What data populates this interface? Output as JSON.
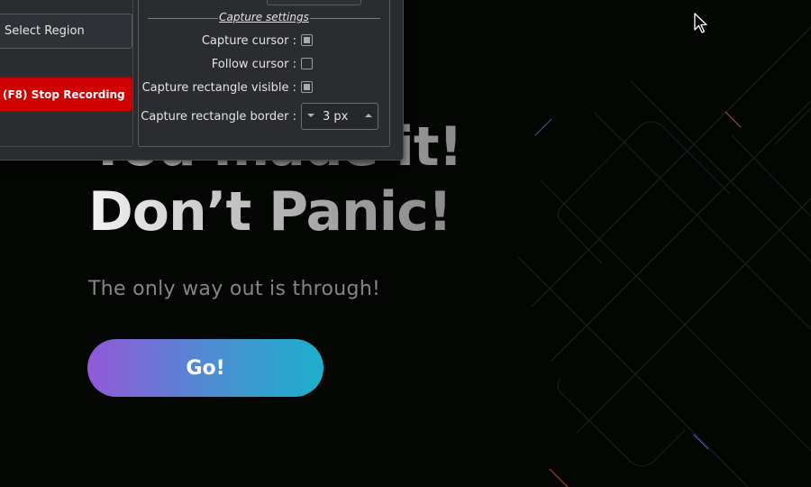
{
  "hero": {
    "line1": "You made it!",
    "line2": "Don’t Panic!",
    "subtitle": "The only way out is through!",
    "cta_label": "Go!"
  },
  "recorder": {
    "select_region_label": "Select Region",
    "stop_recording_label": "(F8) Stop Recording",
    "group_title": "Capture settings",
    "capture_cursor_label": "Capture cursor :",
    "capture_cursor_checked": true,
    "follow_cursor_label": "Follow cursor :",
    "follow_cursor_checked": false,
    "rect_visible_label": "Capture rectangle visible :",
    "rect_visible_checked": true,
    "rect_border_label": "Capture rectangle border :",
    "rect_border_value": "3 px"
  },
  "colors": {
    "page_background": "#040604",
    "stop_button": "#d00000",
    "cta_gradient_start": "#9358d8",
    "cta_gradient_end": "#1db0cc",
    "window_background": "#2a2c30"
  },
  "icons": {
    "cursor": "arrow-cursor-icon",
    "spin_down": "triangle-down-icon",
    "spin_up": "triangle-up-icon"
  }
}
